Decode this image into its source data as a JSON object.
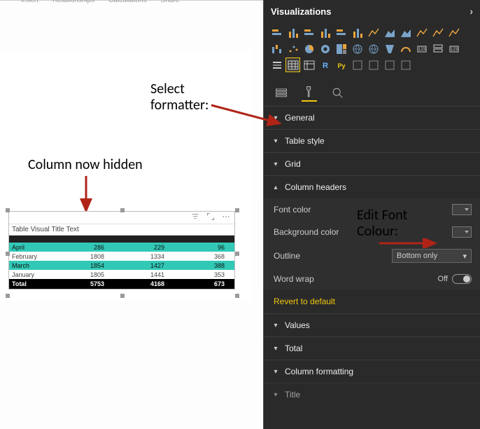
{
  "ribbon": {
    "items": [
      "Insert",
      "Relationships",
      "Calculations",
      "Share"
    ]
  },
  "annotations": {
    "select_formatter": "Select\nformatter:",
    "column_hidden": "Column now hidden",
    "edit_font_colour": "Edit Font\nColour:"
  },
  "table_visual": {
    "title": "Table Visual Title Text",
    "rows": [
      {
        "label": "April",
        "v1": 286,
        "v2": 229,
        "v3": 96
      },
      {
        "label": "February",
        "v1": 1808,
        "v2": 1334,
        "v3": 368
      },
      {
        "label": "March",
        "v1": 1854,
        "v2": 1427,
        "v3": 388
      },
      {
        "label": "January",
        "v1": 1805,
        "v2": 1441,
        "v3": 353
      }
    ],
    "total": {
      "label": "Total",
      "v1": 5753,
      "v2": 4168,
      "v3": 673
    }
  },
  "panel": {
    "title": "Visualizations",
    "tabs": {
      "fields": "Fields",
      "format": "Format",
      "analytics": "Analytics"
    },
    "sections": {
      "general": "General",
      "table_style": "Table style",
      "grid": "Grid",
      "column_headers": "Column headers",
      "values": "Values",
      "total": "Total",
      "column_formatting": "Column formatting",
      "title": "Title"
    },
    "column_headers": {
      "font_color": "Font color",
      "background_color": "Background color",
      "outline_label": "Outline",
      "outline_value": "Bottom only",
      "word_wrap_label": "Word wrap",
      "word_wrap_state": "Off"
    },
    "revert": "Revert to default"
  },
  "viz_names": [
    "stacked-bar",
    "stacked-column",
    "clustered-bar",
    "clustered-column",
    "100-stacked-bar",
    "100-stacked-column",
    "line",
    "area",
    "stacked-area",
    "line-clustered",
    "line-stacked",
    "ribbon",
    "waterfall",
    "scatter",
    "pie",
    "donut",
    "treemap",
    "map",
    "filled-map",
    "funnel",
    "gauge",
    "card",
    "multi-row",
    "kpi",
    "slicer",
    "table",
    "matrix",
    "r-visual",
    "py-visual",
    "key-influencers",
    "decomposition",
    "qa",
    "store"
  ],
  "selected_viz_index": 25
}
